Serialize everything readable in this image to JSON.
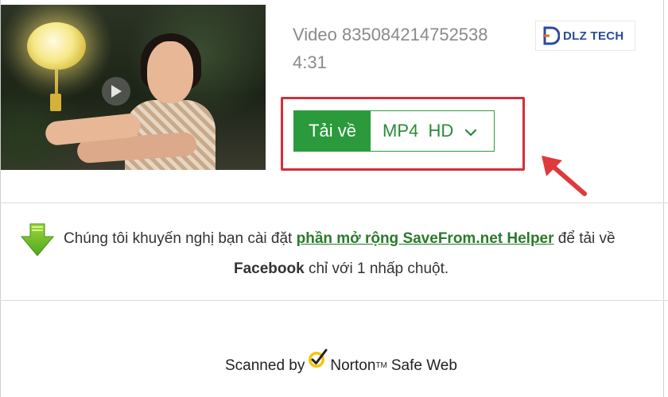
{
  "video": {
    "title": "Video 835084214752538",
    "duration": "4:31"
  },
  "logo": {
    "text": "DLZ TECH"
  },
  "download": {
    "button_label": "Tải về",
    "format_label": "MP4  HD"
  },
  "recommendation": {
    "text_before": "Chúng tôi khuyến nghị bạn cài đặt ",
    "link_text": "phần mở rộng SaveFrom.net Helper",
    "text_after": " để tải về",
    "platform": "Facebook",
    "text_end": " chỉ với 1 nhấp chuột."
  },
  "footer": {
    "scanned_by": "Scanned by",
    "norton": "Norton",
    "tm": "TM",
    "safe_web": "Safe Web"
  },
  "colors": {
    "accent_green": "#2a9a3c",
    "link_green": "#2a7a2a",
    "highlight_red": "#d32f3a"
  },
  "icons": [
    "play-icon",
    "chevron-down-icon",
    "download-arrow-icon",
    "norton-check-icon",
    "red-arrow-annotation"
  ]
}
